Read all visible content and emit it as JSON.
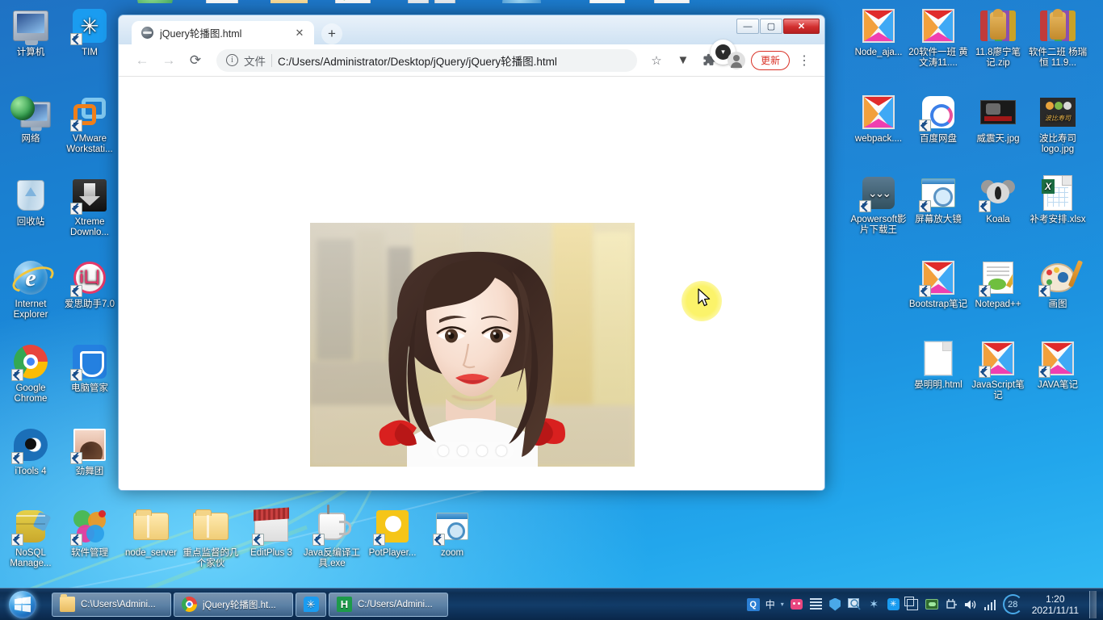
{
  "desktop": {
    "left_icons": [
      {
        "label": "计算机",
        "art": "monitor",
        "shortcut": false
      },
      {
        "label": "TIM",
        "art": "tim",
        "shortcut": true
      },
      {
        "label": "网络",
        "art": "network",
        "shortcut": false
      },
      {
        "label": "VMware Workstati...",
        "art": "vmware",
        "shortcut": true
      },
      {
        "label": "回收站",
        "art": "recycle",
        "shortcut": false
      },
      {
        "label": "Xtreme Downlo...",
        "art": "xtreme",
        "shortcut": true
      },
      {
        "label": "Internet Explorer",
        "art": "ie",
        "shortcut": false
      },
      {
        "label": "爱思助手7.0",
        "art": "aisi",
        "shortcut": true
      },
      {
        "label": "Google Chrome",
        "art": "chrome",
        "shortcut": true
      },
      {
        "label": "电脑管家",
        "art": "pcmgr",
        "shortcut": true
      },
      {
        "label": "iTools 4",
        "art": "itools",
        "shortcut": true
      },
      {
        "label": "劲舞团",
        "art": "photo",
        "shortcut": true
      }
    ],
    "bottom_icons": [
      {
        "label": "NoSQL Manage...",
        "art": "nosql",
        "shortcut": true
      },
      {
        "label": "软件管理",
        "art": "softmgr",
        "shortcut": true
      },
      {
        "label": "node_server",
        "art": "folder",
        "shortcut": false
      },
      {
        "label": "重点监督的几个家伙",
        "art": "folder",
        "shortcut": false
      },
      {
        "label": "EditPlus 3",
        "art": "editplus",
        "shortcut": true
      },
      {
        "label": "Java反编译工具.exe",
        "art": "java",
        "shortcut": true
      },
      {
        "label": "PotPlayer...",
        "art": "pot",
        "shortcut": true
      },
      {
        "label": "zoom",
        "art": "zoom",
        "shortcut": true
      }
    ],
    "right_icons": [
      {
        "label": "Node_aja...",
        "art": "xfile",
        "shortcut": false
      },
      {
        "label": "20软件一班 黄文涛11....",
        "art": "xfile",
        "shortcut": false
      },
      {
        "label": "11.8廖宁笔记.zip",
        "art": "rar",
        "shortcut": false
      },
      {
        "label": "软件二班 杨瑞恒 11.9...",
        "art": "rar",
        "shortcut": false
      },
      {
        "label": "webpack....",
        "art": "xfile",
        "shortcut": false
      },
      {
        "label": "百度网盘",
        "art": "baidu",
        "shortcut": true
      },
      {
        "label": "威震天.jpg",
        "art": "wzt",
        "shortcut": false
      },
      {
        "label": "波比寿司logo.jpg",
        "art": "sushi",
        "shortcut": false
      },
      {
        "label": "Apowersoft影片下载王",
        "art": "apower",
        "shortcut": true
      },
      {
        "label": "屏幕放大镜",
        "art": "magnifier",
        "shortcut": true
      },
      {
        "label": "Koala",
        "art": "koala",
        "shortcut": true
      },
      {
        "label": "补考安排.xlsx",
        "art": "xlsx",
        "shortcut": false
      },
      {
        "label": "Bootstrap笔记",
        "art": "xfile",
        "shortcut": true
      },
      {
        "label": "Notepad++",
        "art": "npp",
        "shortcut": true
      },
      {
        "label": "画图",
        "art": "paint",
        "shortcut": true
      },
      {
        "label": "晏明明.html",
        "art": "htmlfile",
        "shortcut": false
      },
      {
        "label": "JavaScript笔记",
        "art": "xfile",
        "shortcut": true
      },
      {
        "label": "JAVA笔记",
        "art": "xfile",
        "shortcut": true
      }
    ]
  },
  "browser": {
    "window_controls": {
      "minimize": "—",
      "maximize": "▢",
      "close": "✕"
    },
    "tab": {
      "title": "jQuery轮播图.html",
      "close_label": "✕",
      "favicon": "globe-icon"
    },
    "new_tab_label": "+",
    "download_chip_label": "▾",
    "toolbar": {
      "back_label": "←",
      "forward_label": "→",
      "reload_label": "⟳",
      "info_label": "i",
      "scheme_label": "文件",
      "url": "C:/Users/Administrator/Desktop/jQuery/jQuery轮播图.html",
      "bookmark_label": "☆",
      "extension_v_label": "▼",
      "puzzle_label": "🧩",
      "profile_label": "avatar-icon",
      "update_label": "更新",
      "menu_label": "⋮"
    },
    "page": {
      "carousel": {
        "slide_count": 4,
        "active_index": 3,
        "dots": [
          "1",
          "2",
          "3",
          "4"
        ]
      }
    }
  },
  "taskbar": {
    "start_label": "开始",
    "tasks": [
      {
        "label": "C:\\Users\\Admini...",
        "icon": "folder-icon"
      },
      {
        "label": "jQuery轮播图.ht...",
        "icon": "chrome-icon"
      },
      {
        "label": "",
        "icon": "tim-icon"
      },
      {
        "label": "C:/Users/Admini...",
        "icon": "hbuilder-icon"
      }
    ],
    "tray": {
      "ime_q_label": "Q",
      "ime_lang_label": "中",
      "ime_caret_label": "▾",
      "temperature_label": "28",
      "time": "1:20",
      "date": "2021/11/11"
    }
  },
  "colors": {
    "desktop_blue": "#1b8ada",
    "taskbar_blue": "#0c2a4e",
    "chrome_update_red": "#d93025",
    "cursor_highlight": "#fbf36a"
  }
}
